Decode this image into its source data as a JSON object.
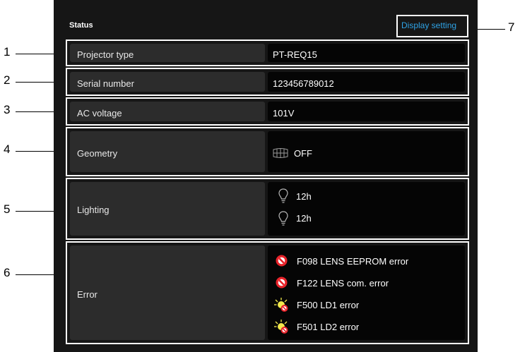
{
  "header": {
    "title": "Status",
    "display_setting": "Display setting"
  },
  "rows": {
    "projector_type": {
      "label": "Projector type",
      "value": "PT-REQ15"
    },
    "serial_number": {
      "label": "Serial number",
      "value": "123456789012"
    },
    "ac_voltage": {
      "label": "AC voltage",
      "value": "101V"
    },
    "geometry": {
      "label": "Geometry",
      "value": "OFF"
    },
    "lighting": {
      "label": "Lighting",
      "values": [
        "12h",
        "12h"
      ]
    },
    "error": {
      "label": "Error",
      "items": [
        {
          "text": "F098 LENS EEPROM error",
          "icon": "prohibited-icon"
        },
        {
          "text": "F122 LENS com. error",
          "icon": "prohibited-icon"
        },
        {
          "text": "F500 LD1 error",
          "icon": "laser-diode-error-icon"
        },
        {
          "text": "F501 LD2 error",
          "icon": "laser-diode-error-icon"
        }
      ]
    }
  },
  "callouts": [
    "1",
    "2",
    "3",
    "4",
    "5",
    "6",
    "7"
  ],
  "colors": {
    "panel": "#161616",
    "label_cell": "#2c2c2c",
    "value_cell": "#050505",
    "link": "#2fa3e6",
    "error_red": "#e8232a",
    "lamp_yellow": "#f2e94c"
  }
}
